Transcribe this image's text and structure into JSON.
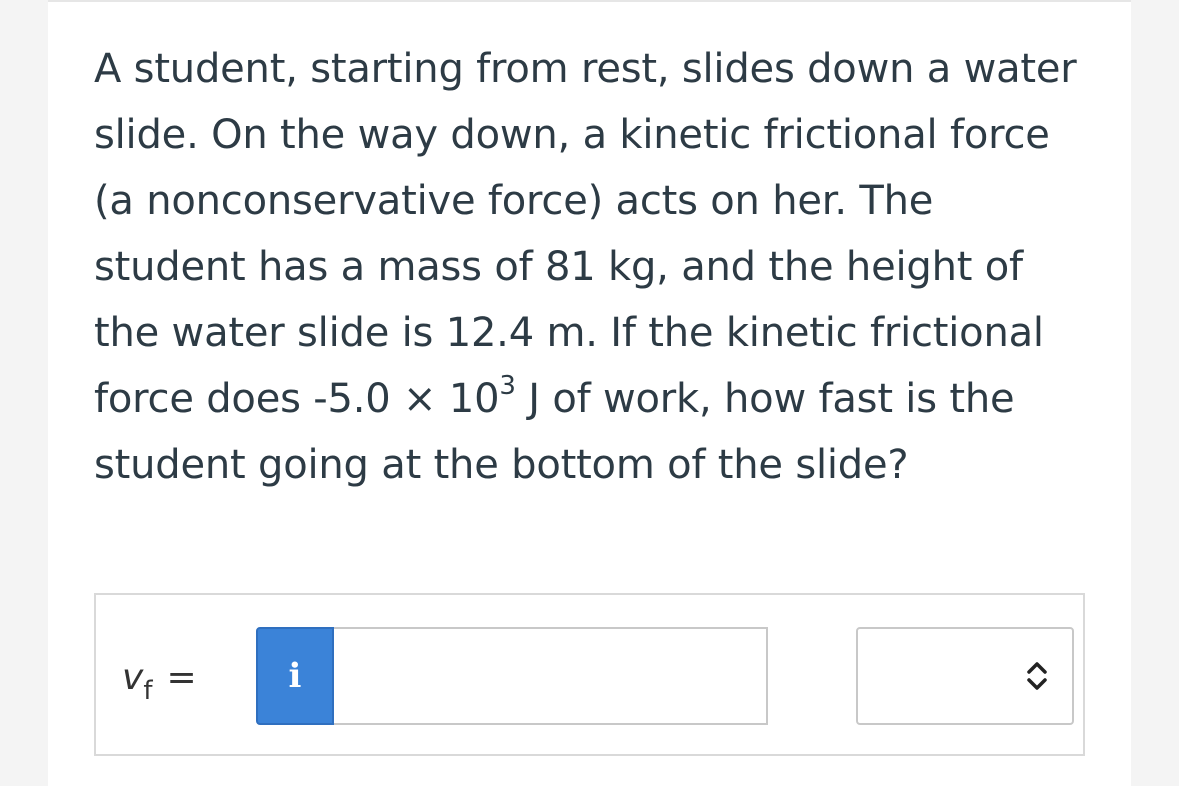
{
  "question": {
    "text_before_exp": "A student, starting from rest, slides down a water slide. On the way down, a kinetic frictional force (a nonconservative force) acts on her. The student has a mass of 81 kg, and the height of the water slide is 12.4 m. If the kinetic frictional force does -5.0 × 10",
    "exponent": "3",
    "text_after_exp": " J of work, how fast is the student going at the bottom of the slide?"
  },
  "answer": {
    "variable": "v",
    "subscript": "f",
    "equals": "=",
    "info_button_label": "i",
    "value": "",
    "placeholder": "",
    "unit_selected": "",
    "unit_icon": "chevron-up-down-icon"
  },
  "colors": {
    "info_button": "#3b83d8",
    "text": "#2d3b45"
  }
}
